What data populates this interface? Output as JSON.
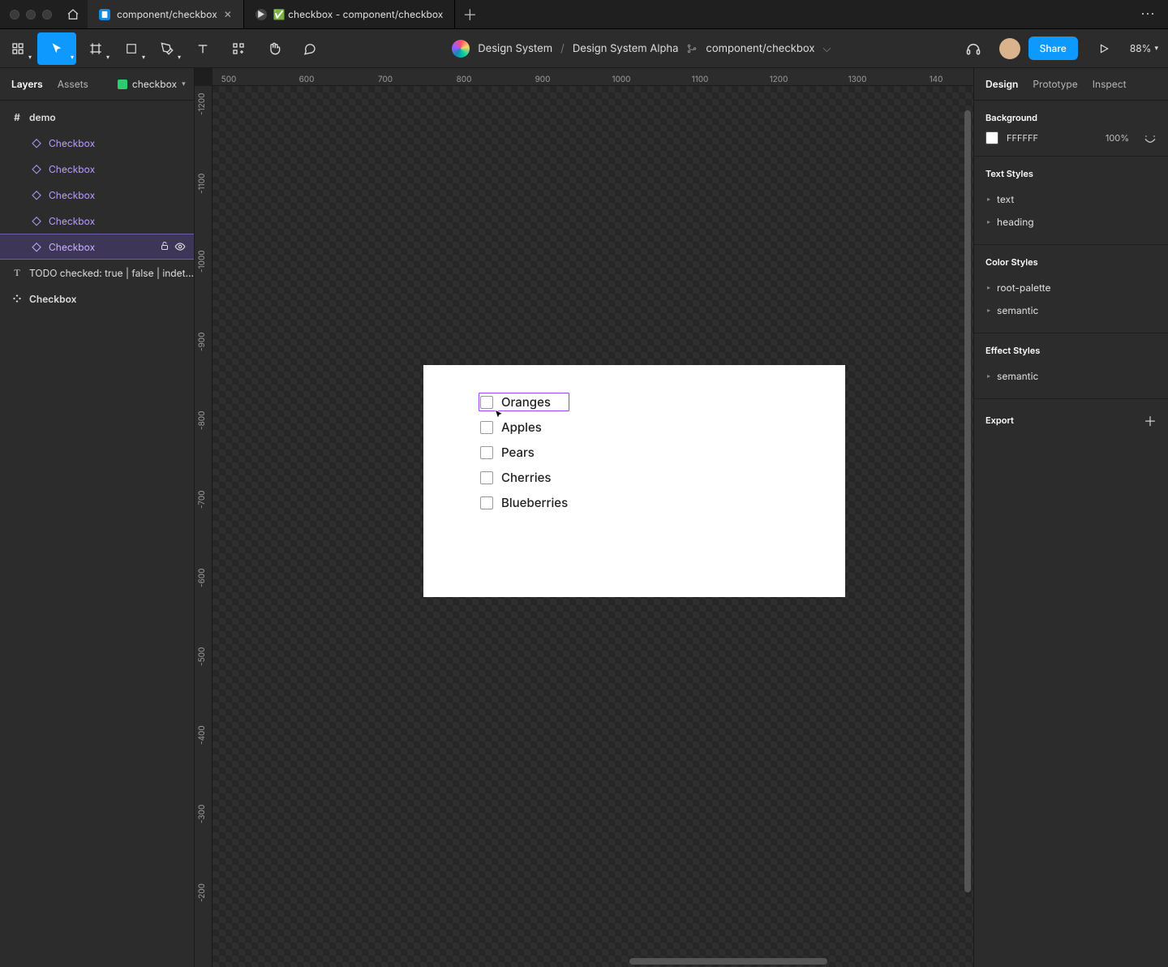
{
  "titlebar": {
    "tabs": [
      {
        "label": "component/checkbox",
        "icon_kind": "file",
        "active": true,
        "closeable": true
      },
      {
        "label": "✅ checkbox - component/checkbox",
        "icon_kind": "proto",
        "active": false,
        "closeable": false
      }
    ]
  },
  "toolbar": {
    "breadcrumb": {
      "team": "Design System",
      "project": "Design System Alpha",
      "file": "component/checkbox"
    },
    "share_label": "Share",
    "zoom": "88%"
  },
  "left_panel": {
    "tabs": {
      "layers": "Layers",
      "assets": "Assets"
    },
    "page_name": "checkbox",
    "tree": [
      {
        "kind": "frame",
        "label": "demo",
        "bold": true,
        "indent": 0
      },
      {
        "kind": "instance",
        "label": "Checkbox",
        "bold": false,
        "indent": 1
      },
      {
        "kind": "instance",
        "label": "Checkbox",
        "bold": false,
        "indent": 1
      },
      {
        "kind": "instance",
        "label": "Checkbox",
        "bold": false,
        "indent": 1
      },
      {
        "kind": "instance",
        "label": "Checkbox",
        "bold": false,
        "indent": 1
      },
      {
        "kind": "instance",
        "label": "Checkbox",
        "bold": false,
        "indent": 1,
        "selected": true
      },
      {
        "kind": "text",
        "label": "TODO checked: true | false | indet…",
        "bold": false,
        "indent": 0
      },
      {
        "kind": "component",
        "label": "Checkbox",
        "bold": true,
        "indent": 0
      }
    ]
  },
  "canvas": {
    "ruler_h": [
      "500",
      "600",
      "700",
      "800",
      "900",
      "1000",
      "1100",
      "1200",
      "1300",
      "140"
    ],
    "ruler_v": [
      "-1200",
      "-1100",
      "-1000",
      "-900",
      "-800",
      "-700",
      "-600",
      "-500",
      "-400",
      "-300",
      "-200"
    ],
    "checkbox_items": [
      "Oranges",
      "Apples",
      "Pears",
      "Cherries",
      "Blueberries"
    ]
  },
  "right_panel": {
    "tabs": {
      "design": "Design",
      "prototype": "Prototype",
      "inspect": "Inspect"
    },
    "background": {
      "title": "Background",
      "hex": "FFFFFF",
      "opacity": "100%"
    },
    "text_styles": {
      "title": "Text Styles",
      "items": [
        "text",
        "heading"
      ]
    },
    "color_styles": {
      "title": "Color Styles",
      "items": [
        "root-palette",
        "semantic"
      ]
    },
    "effect_styles": {
      "title": "Effect Styles",
      "items": [
        "semantic"
      ]
    },
    "export_title": "Export"
  }
}
